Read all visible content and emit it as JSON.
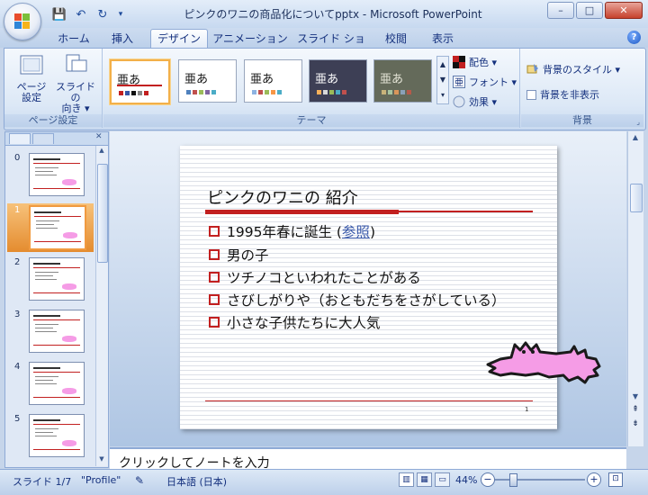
{
  "window": {
    "title": "ピンクのワニの商品化についてpptx - Microsoft PowerPoint",
    "min": "–",
    "max": "□",
    "close": "✕"
  },
  "qat": {
    "save": "💾",
    "undo": "↶",
    "redo": "↻",
    "more": "▾"
  },
  "tabs": [
    {
      "label": "ホーム"
    },
    {
      "label": "挿入"
    },
    {
      "label": "デザイン"
    },
    {
      "label": "アニメーション"
    },
    {
      "label": "スライド ショー"
    },
    {
      "label": "校閲"
    },
    {
      "label": "表示"
    }
  ],
  "active_tab": "デザイン",
  "help": "?",
  "ribbon": {
    "page_setup": {
      "label": "ページ設定",
      "page_btn_1": "ページ",
      "page_btn_2": "設定",
      "orient_btn_1": "スライドの",
      "orient_btn_2": "向き ▾"
    },
    "themes": {
      "label": "テーマ",
      "sample": "亜あ",
      "items": [
        {
          "bg": "#ffffff",
          "fg": "#111111",
          "selected": true
        },
        {
          "bg": "#ffffff",
          "fg": "#111111"
        },
        {
          "bg": "#ffffff",
          "fg": "#111111"
        },
        {
          "bg": "#3d3f55",
          "fg": "#ffffff"
        },
        {
          "bg": "#646a5a",
          "fg": "#e6e6d8"
        }
      ],
      "colors": "配色 ▾",
      "fonts": "フォント ▾",
      "effects": "効果 ▾"
    },
    "background": {
      "label": "背景",
      "styles": "背景のスタイル ▾",
      "hide": "背景を非表示"
    }
  },
  "thumbnails": [
    "0",
    "1",
    "2",
    "3",
    "4",
    "5"
  ],
  "selected_slide_index": 1,
  "slide": {
    "title": "ピンクのワニの 紹介",
    "bullets": [
      {
        "pre": "1995年春に誕生 (",
        "link": "参照",
        "post": ")"
      },
      {
        "text": "男の子"
      },
      {
        "text": "ツチノコといわれたことがある"
      },
      {
        "text": "さびしがりや（おともだちをさがしている）"
      },
      {
        "text": "小さな子供たちに大人気"
      }
    ],
    "number": "1"
  },
  "notes": {
    "placeholder": "クリックしてノートを入力"
  },
  "status": {
    "slide": "スライド 1/7",
    "theme": "\"Profile\"",
    "language": "日本語 (日本)",
    "zoom": "44%",
    "zoom_minus": "−",
    "zoom_plus": "+"
  },
  "colors": {
    "accent_red": "#c22020",
    "croc_pink": "#f59ce6",
    "selection_orange": "#f09a40"
  }
}
